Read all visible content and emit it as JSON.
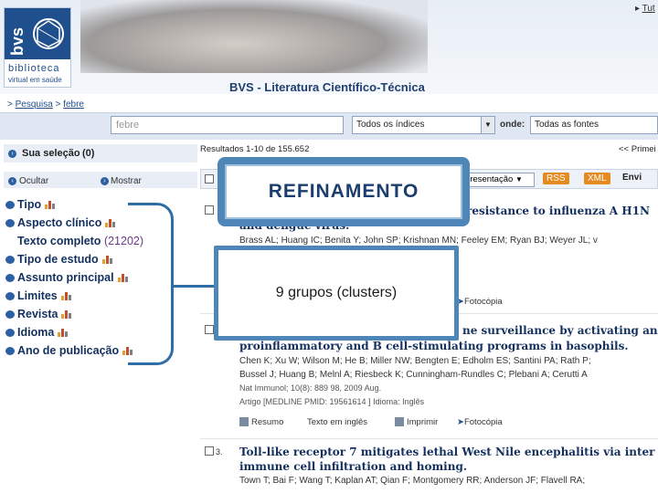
{
  "header": {
    "logo_bvs": "bvs",
    "logo_line1": "biblioteca",
    "logo_line2": "virtual em saúde",
    "site_title": "BVS - Literatura Científico-Técnica",
    "tutorial_link": "Tut"
  },
  "breadcrumb": {
    "items": [
      "Pesquisa",
      "febre"
    ],
    "separator": ">"
  },
  "search": {
    "query": "febre",
    "index_select": "Todos os índices",
    "where_label": "onde:",
    "sources_select": "Todas as fontes"
  },
  "sidebar": {
    "selection_label": "Sua seleção",
    "selection_count": "(0)",
    "hide_label": "Ocultar",
    "show_label": "Mostrar",
    "clusters": [
      {
        "label": "Tipo",
        "has_chart": true
      },
      {
        "label": "Aspecto clínico",
        "has_chart": true
      },
      {
        "label": "Texto completo",
        "count": "(21202)",
        "has_chart": false
      },
      {
        "label": "Tipo de estudo",
        "has_chart": true
      },
      {
        "label": "Assunto principal",
        "has_chart": true
      },
      {
        "label": "Limites",
        "has_chart": true
      },
      {
        "label": "Revista",
        "has_chart": true
      },
      {
        "label": "Idioma",
        "has_chart": true
      },
      {
        "label": "Ano de publicação",
        "has_chart": true
      }
    ]
  },
  "results": {
    "header": "Resultados 1-10 de 155.652",
    "first_link": "<< Primei",
    "toolbar": {
      "presentation": "presentação",
      "rss": "RSS",
      "xml": "XML",
      "send": "Envi"
    },
    "items": [
      {
        "title_visible": "resistance to influenza A H1N",
        "title_line2": "and dengue virus.",
        "authors": "Brass AL; Huang IC; Benita Y; John SP; Krishnan MN; Feeley EM; Ryan BJ; Weyer JL; v",
        "action_photocopy": "Fotocópia"
      },
      {
        "title_visible": "ne surveillance by activating an",
        "title_line2": "proinflammatory and B cell-stimulating programs in basophils.",
        "authors": "Chen K; Xu W; Wilson M; He B; Miller NW; Bengten E; Edholm ES; Santini PA; Rath P;",
        "authors2": "Bussel J; Huang B; Melnl A; Riesbeck K; Cunningham-Rundles C; Plebani A; Cerutti A",
        "citation": "Nat Immunol; 10(8): 889 98, 2009 Aug.",
        "meta": "Artigo [MEDLINE PMID: 19561614 ] Idioma: Inglês",
        "action_summary": "Resumo",
        "action_fulltext": "Texto em inglês",
        "action_print": "Imprimir",
        "action_photocopy": "Fotocópia"
      },
      {
        "number": "3.",
        "title": "Toll-like receptor 7 mitigates lethal West Nile encephalitis via inter",
        "title_line2": "immune cell infiltration and homing.",
        "authors": "Town T; Bai F; Wang T; Kaplan AT; Qian F; Montgomery RR; Anderson JF; Flavell RA;"
      }
    ]
  },
  "overlay": {
    "refine_label": "REFINAMENTO",
    "clusters_label": "9 grupos (clusters)"
  },
  "colors": {
    "brand_blue": "#1f4f8c",
    "overlay_border": "#4f86b8",
    "link_navy": "#13305e",
    "feed_orange": "#e58a1f"
  }
}
